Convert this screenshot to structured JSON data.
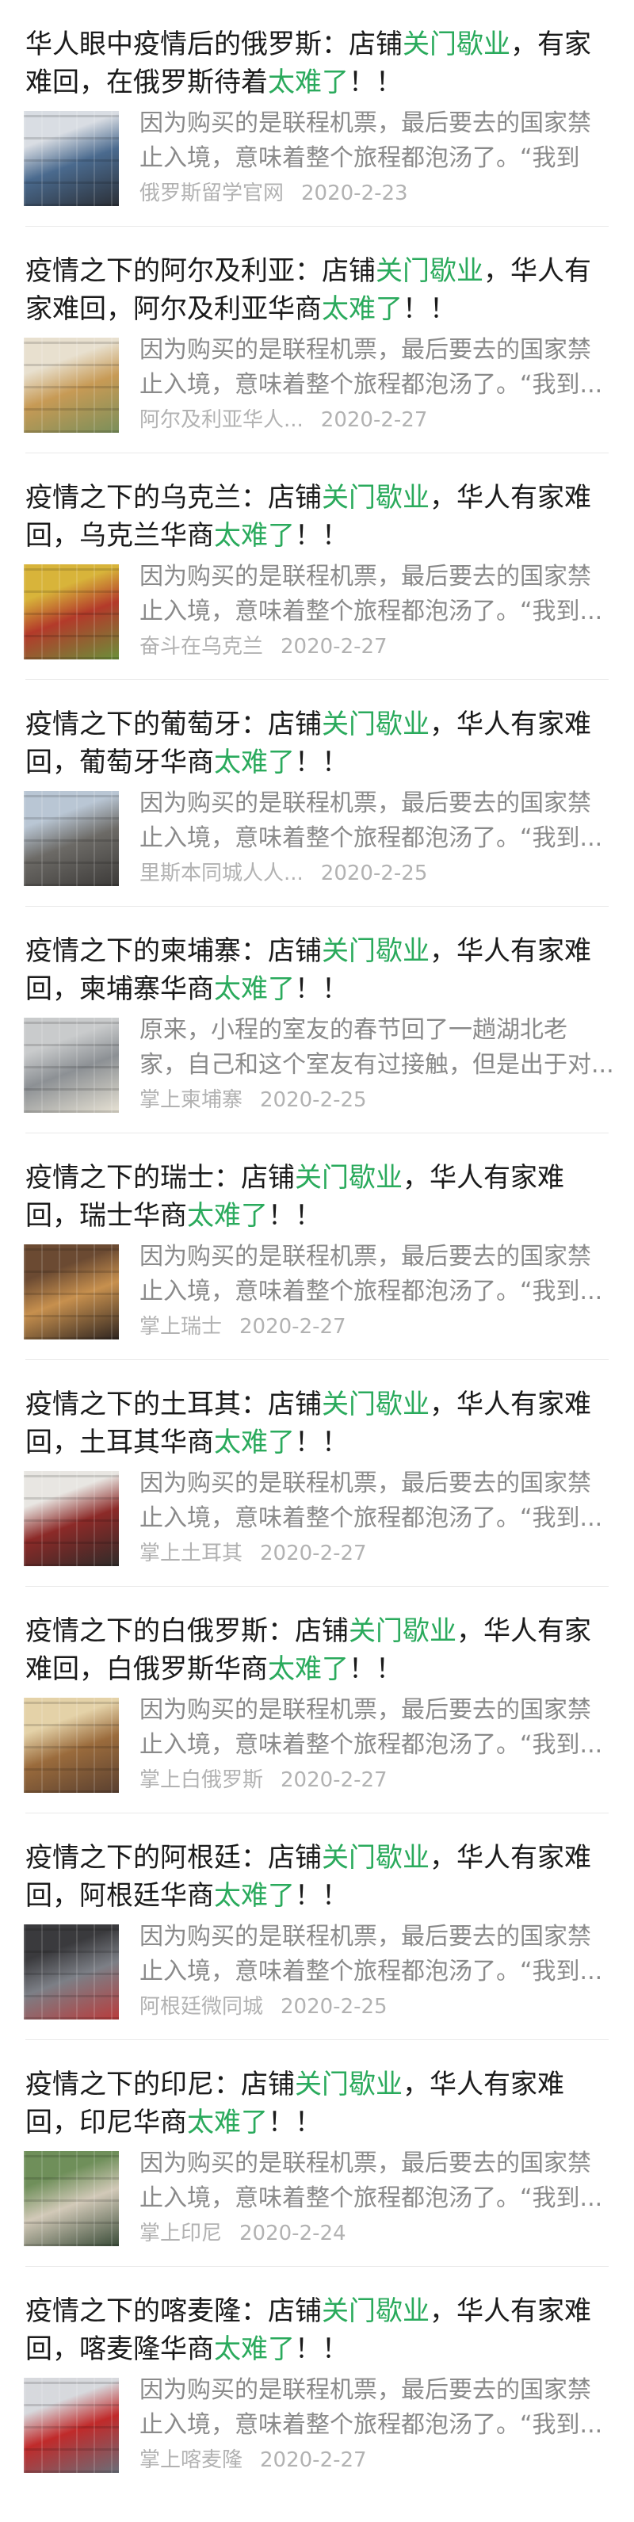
{
  "highlight_color": "#2aaa5c",
  "articles": [
    {
      "title_lines": [
        [
          {
            "t": "华人眼中疫情后的俄罗斯：店铺",
            "hl": false
          },
          {
            "t": "关门歇业",
            "hl": true
          },
          {
            "t": "，有家",
            "hl": false
          }
        ],
        [
          {
            "t": "难回，在俄罗斯待着",
            "hl": false
          },
          {
            "t": "太难了",
            "hl": true
          },
          {
            "t": "！！",
            "hl": false
          }
        ]
      ],
      "summary_lines": [
        "因为购买的是联程机票，最后要去的国家禁",
        "止入境，意味着整个旅程都泡汤了。“我到"
      ],
      "source": "俄罗斯留学官网",
      "date": "2020-2-23",
      "thumb_colors": [
        "#d9dde3",
        "#4a6a8e",
        "#2b2f36"
      ]
    },
    {
      "title_lines": [
        [
          {
            "t": "疫情之下的阿尔及利亚：店铺",
            "hl": false
          },
          {
            "t": "关门歇业",
            "hl": true
          },
          {
            "t": "，华人有",
            "hl": false
          }
        ],
        [
          {
            "t": "家难回，阿尔及利亚华商",
            "hl": false
          },
          {
            "t": "太难了",
            "hl": true
          },
          {
            "t": "！！",
            "hl": false
          }
        ]
      ],
      "summary_lines": [
        "因为购买的是联程机票，最后要去的国家禁",
        "止入境，意味着整个旅程都泡汤了。“我到..."
      ],
      "source": "阿尔及利亚华人...",
      "date": "2020-2-27",
      "thumb_colors": [
        "#e8e0cf",
        "#c79a55",
        "#7a8f5a"
      ]
    },
    {
      "title_lines": [
        [
          {
            "t": "疫情之下的乌克兰：店铺",
            "hl": false
          },
          {
            "t": "关门歇业",
            "hl": true
          },
          {
            "t": "，华人有家难",
            "hl": false
          }
        ],
        [
          {
            "t": "回，乌克兰华商",
            "hl": false
          },
          {
            "t": "太难了",
            "hl": true
          },
          {
            "t": "！！",
            "hl": false
          }
        ]
      ],
      "summary_lines": [
        "因为购买的是联程机票，最后要去的国家禁",
        "止入境，意味着整个旅程都泡汤了。“我到..."
      ],
      "source": "奋斗在乌克兰",
      "date": "2020-2-27",
      "thumb_colors": [
        "#d8b43a",
        "#b33a2a",
        "#6b8f3a"
      ]
    },
    {
      "title_lines": [
        [
          {
            "t": "疫情之下的葡萄牙：店铺",
            "hl": false
          },
          {
            "t": "关门歇业",
            "hl": true
          },
          {
            "t": "，华人有家难",
            "hl": false
          }
        ],
        [
          {
            "t": "回，葡萄牙华商",
            "hl": false
          },
          {
            "t": "太难了",
            "hl": true
          },
          {
            "t": "！！",
            "hl": false
          }
        ]
      ],
      "summary_lines": [
        "因为购买的是联程机票，最后要去的国家禁",
        "止入境，意味着整个旅程都泡汤了。“我到..."
      ],
      "source": "里斯本同城人人...",
      "date": "2020-2-25",
      "thumb_colors": [
        "#b9c6d4",
        "#6c6a66",
        "#3c3a38"
      ]
    },
    {
      "title_lines": [
        [
          {
            "t": "疫情之下的柬埔寨：店铺",
            "hl": false
          },
          {
            "t": "关门歇业",
            "hl": true
          },
          {
            "t": "，华人有家难",
            "hl": false
          }
        ],
        [
          {
            "t": "回，柬埔寨华商",
            "hl": false
          },
          {
            "t": "太难了",
            "hl": true
          },
          {
            "t": "！！",
            "hl": false
          }
        ]
      ],
      "summary_lines": [
        "原来，小程的室友的春节回了一趟湖北老",
        "家，自己和这个室友有过接触，但是出于对..."
      ],
      "source": "掌上柬埔寨",
      "date": "2020-2-25",
      "thumb_colors": [
        "#c9cbcc",
        "#8c9094",
        "#e7e2d4"
      ]
    },
    {
      "title_lines": [
        [
          {
            "t": "疫情之下的瑞士：店铺",
            "hl": false
          },
          {
            "t": "关门歇业",
            "hl": true
          },
          {
            "t": "，华人有家难",
            "hl": false
          }
        ],
        [
          {
            "t": "回，瑞士华商",
            "hl": false
          },
          {
            "t": "太难了",
            "hl": true
          },
          {
            "t": "！！",
            "hl": false
          }
        ]
      ],
      "summary_lines": [
        "因为购买的是联程机票，最后要去的国家禁",
        "止入境，意味着整个旅程都泡汤了。“我到..."
      ],
      "source": "掌上瑞士",
      "date": "2020-2-27",
      "thumb_colors": [
        "#6b4a32",
        "#c7904e",
        "#2e2420"
      ]
    },
    {
      "title_lines": [
        [
          {
            "t": "疫情之下的土耳其：店铺",
            "hl": false
          },
          {
            "t": "关门歇业",
            "hl": true
          },
          {
            "t": "，华人有家难",
            "hl": false
          }
        ],
        [
          {
            "t": "回，土耳其华商",
            "hl": false
          },
          {
            "t": "太难了",
            "hl": true
          },
          {
            "t": "！！",
            "hl": false
          }
        ]
      ],
      "summary_lines": [
        "因为购买的是联程机票，最后要去的国家禁",
        "止入境，意味着整个旅程都泡汤了。“我到..."
      ],
      "source": "掌上土耳其",
      "date": "2020-2-27",
      "thumb_colors": [
        "#e8e6e2",
        "#8c2a28",
        "#2f2b29"
      ]
    },
    {
      "title_lines": [
        [
          {
            "t": "疫情之下的白俄罗斯：店铺",
            "hl": false
          },
          {
            "t": "关门歇业",
            "hl": true
          },
          {
            "t": "，华人有家",
            "hl": false
          }
        ],
        [
          {
            "t": "难回，白俄罗斯华商",
            "hl": false
          },
          {
            "t": "太难了",
            "hl": true
          },
          {
            "t": "！！",
            "hl": false
          }
        ]
      ],
      "summary_lines": [
        "因为购买的是联程机票，最后要去的国家禁",
        "止入境，意味着整个旅程都泡汤了。“我到..."
      ],
      "source": "掌上白俄罗斯",
      "date": "2020-2-27",
      "thumb_colors": [
        "#e4d2a8",
        "#9a6b3c",
        "#5a4030"
      ]
    },
    {
      "title_lines": [
        [
          {
            "t": "疫情之下的阿根廷：店铺",
            "hl": false
          },
          {
            "t": "关门歇业",
            "hl": true
          },
          {
            "t": "，华人有家难",
            "hl": false
          }
        ],
        [
          {
            "t": "回，阿根廷华商",
            "hl": false
          },
          {
            "t": "太难了",
            "hl": true
          },
          {
            "t": "！！",
            "hl": false
          }
        ]
      ],
      "summary_lines": [
        "因为购买的是联程机票，最后要去的国家禁",
        "止入境，意味着整个旅程都泡汤了。“我到..."
      ],
      "source": "阿根廷微同城",
      "date": "2020-2-25",
      "thumb_colors": [
        "#3a3a3d",
        "#7c7f86",
        "#b83c3c"
      ]
    },
    {
      "title_lines": [
        [
          {
            "t": "疫情之下的印尼：店铺",
            "hl": false
          },
          {
            "t": "关门歇业",
            "hl": true
          },
          {
            "t": "，华人有家难",
            "hl": false
          }
        ],
        [
          {
            "t": "回，印尼华商",
            "hl": false
          },
          {
            "t": "太难了",
            "hl": true
          },
          {
            "t": "！！",
            "hl": false
          }
        ]
      ],
      "summary_lines": [
        "因为购买的是联程机票，最后要去的国家禁",
        "止入境，意味着整个旅程都泡汤了。“我到..."
      ],
      "source": "掌上印尼",
      "date": "2020-2-24",
      "thumb_colors": [
        "#6f8f5a",
        "#d2c9b8",
        "#3a4c38"
      ]
    },
    {
      "title_lines": [
        [
          {
            "t": "疫情之下的喀麦隆：店铺",
            "hl": false
          },
          {
            "t": "关门歇业",
            "hl": true
          },
          {
            "t": "，华人有家难",
            "hl": false
          }
        ],
        [
          {
            "t": "回，喀麦隆华商",
            "hl": false
          },
          {
            "t": "太难了",
            "hl": true
          },
          {
            "t": "！！",
            "hl": false
          }
        ]
      ],
      "summary_lines": [
        "因为购买的是联程机票，最后要去的国家禁",
        "止入境，意味着整个旅程都泡汤了。“我到..."
      ],
      "source": "掌上喀麦隆",
      "date": "2020-2-27",
      "thumb_colors": [
        "#d7d9dd",
        "#c02a2a",
        "#6a6e78"
      ]
    }
  ]
}
